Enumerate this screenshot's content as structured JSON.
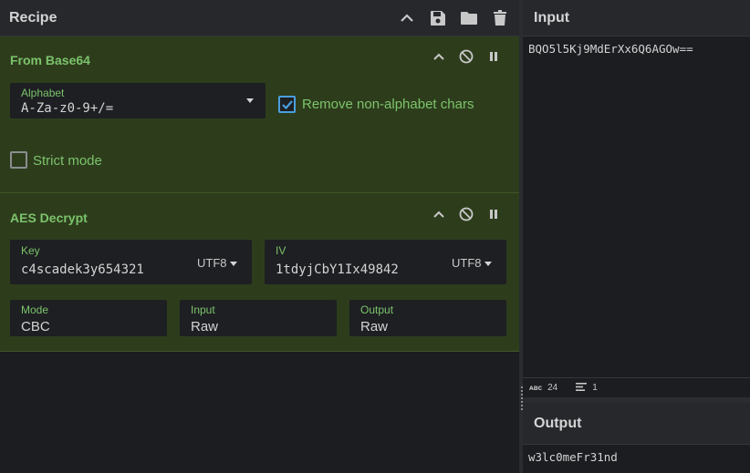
{
  "recipe": {
    "title": "Recipe",
    "icons": [
      "chevron-up-icon",
      "save-icon",
      "folder-icon",
      "trash-icon"
    ]
  },
  "from_base64": {
    "title": "From Base64",
    "alphabet_label": "Alphabet",
    "alphabet_value": "A-Za-z0-9+/=",
    "remove_non_alphabet_label": "Remove non-alphabet chars",
    "remove_non_alphabet_checked": true,
    "strict_mode_label": "Strict mode",
    "strict_mode_checked": false
  },
  "aes_decrypt": {
    "title": "AES Decrypt",
    "key_label": "Key",
    "key_value": "c4scadek3y654321",
    "key_encoding": "UTF8",
    "iv_label": "IV",
    "iv_value": "1tdyjCbY1Ix49842",
    "iv_encoding": "UTF8",
    "mode_label": "Mode",
    "mode_value": "CBC",
    "input_label": "Input",
    "input_value": "Raw",
    "output_label": "Output",
    "output_value": "Raw"
  },
  "input_pane": {
    "title": "Input",
    "text": "BQO5l5Kj9MdErXx6Q6AGOw==",
    "status_abc": "ᴀʙc",
    "char_count": "24",
    "line_count": "1"
  },
  "output_pane": {
    "title": "Output",
    "text": "w3lc0meFr31nd"
  },
  "colors": {
    "operation_bg": "#2d3d1c",
    "accent_green": "#7cc36b",
    "checkbox_blue": "#4a9fe0"
  }
}
